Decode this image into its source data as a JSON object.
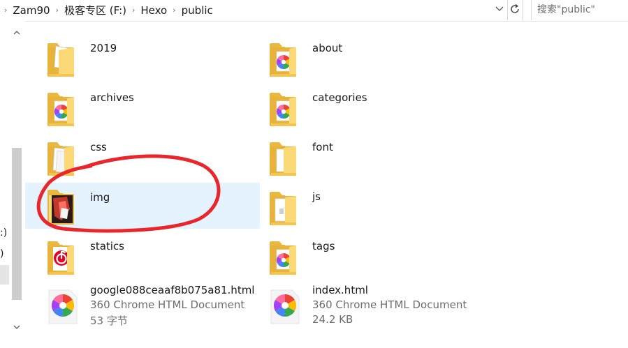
{
  "address_bar": {
    "breadcrumbs": [
      "Zam90",
      "极客专区 (F:)",
      "Hexo",
      "public"
    ],
    "lead_chevron": "›",
    "separator": "›",
    "search_placeholder": "搜索\"public\""
  },
  "nav_pane": {
    "fragments": [
      ":)",
      ")"
    ]
  },
  "folders": [
    {
      "name": "2019",
      "icon": "folder-docs-icon"
    },
    {
      "name": "about",
      "icon": "folder-chrome-icon"
    },
    {
      "name": "archives",
      "icon": "folder-chrome-icon"
    },
    {
      "name": "categories",
      "icon": "folder-chrome-icon"
    },
    {
      "name": "css",
      "icon": "folder-docs-icon"
    },
    {
      "name": "font",
      "icon": "folder-plain-icon"
    },
    {
      "name": "img",
      "icon": "folder-image-icon",
      "selected": true
    },
    {
      "name": "js",
      "icon": "folder-script-icon"
    },
    {
      "name": "statics",
      "icon": "folder-netease-icon"
    },
    {
      "name": "tags",
      "icon": "folder-chrome-icon"
    }
  ],
  "files": [
    {
      "name": "google088ceaaf8b075a81.html",
      "type": "360 Chrome HTML Document",
      "size": "53 字节",
      "icon": "chrome-html-icon"
    },
    {
      "name": "index.html",
      "type": "360 Chrome HTML Document",
      "size": "24.2 KB",
      "icon": "chrome-html-icon"
    }
  ],
  "colors": {
    "selection": "#e5f3ff",
    "annotation_circle": "#e8262b",
    "folder_yellow": "#f8d775"
  }
}
